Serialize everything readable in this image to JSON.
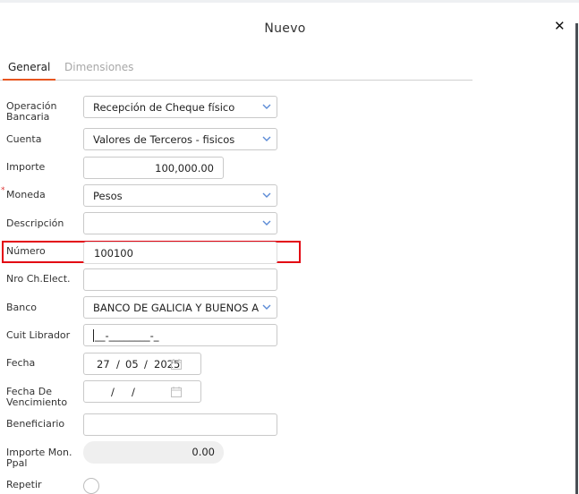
{
  "dialog": {
    "title": "Nuevo",
    "close_glyph": "✕"
  },
  "tabs": [
    {
      "label": "General",
      "active": true
    },
    {
      "label": "Dimensiones",
      "active": false
    }
  ],
  "accent_color": "#e8551f",
  "highlight_color": "#e30613",
  "form": {
    "operacion": {
      "label": "Operación Bancaria",
      "value": "Recepción de Cheque físico"
    },
    "cuenta": {
      "label": "Cuenta",
      "value": "Valores de Terceros - fisicos"
    },
    "importe": {
      "label": "Importe",
      "value": "100,000.00"
    },
    "moneda": {
      "label": "Moneda",
      "value": "Pesos",
      "required_mark": "*"
    },
    "descripcion": {
      "label": "Descripción",
      "value": ""
    },
    "numero": {
      "label": "Número",
      "value": "100100"
    },
    "nro_ch_elect": {
      "label": "Nro Ch.Elect.",
      "value": ""
    },
    "banco": {
      "label": "Banco",
      "value": "BANCO DE GALICIA Y BUENOS A"
    },
    "cuit_librador": {
      "label": "Cuit Librador",
      "value": "__-________-_"
    },
    "fecha": {
      "label": "Fecha",
      "day": "27",
      "month": "05",
      "year": "2025",
      "sep": "/"
    },
    "fecha_vencimiento": {
      "label": "Fecha De Vencimiento",
      "day": "",
      "month": "",
      "year": "",
      "sep": "/"
    },
    "beneficiario": {
      "label": "Beneficiario",
      "value": ""
    },
    "importe_mon_ppal": {
      "label": "Importe Mon. Ppal",
      "value": "0.00"
    },
    "repetir": {
      "label": "Repetir",
      "checked": false
    }
  }
}
